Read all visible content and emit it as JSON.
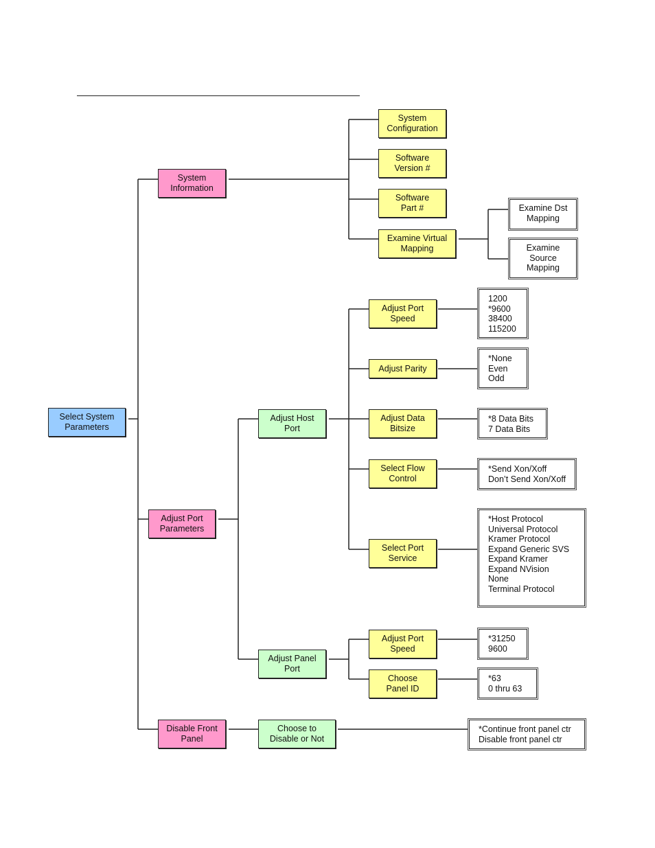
{
  "diagram": {
    "root": {
      "label": "Select System Parameters",
      "color": "#99ccff"
    },
    "colors": {
      "level1": "#ff99cc",
      "level2": "#ccffcc",
      "leaf_menu": "#ffff99",
      "options": "#ffffff"
    },
    "system_information": {
      "label": "System Information",
      "children": [
        {
          "label": "System Configuration"
        },
        {
          "label": "Software Version #"
        },
        {
          "label": "Software Part #"
        },
        {
          "label": "Examine Virtual Mapping",
          "submenus": [
            "Examine Dst Mapping",
            "Examine Source Mapping"
          ]
        }
      ]
    },
    "adjust_port_parameters": {
      "label": "Adjust Port Parameters",
      "host_port": {
        "label": "Adjust Host Port",
        "items": [
          {
            "label": "Adjust Port Speed",
            "options": [
              "1200",
              "*9600",
              "38400",
              "115200"
            ]
          },
          {
            "label": "Adjust Parity",
            "options": [
              "*None",
              "Even",
              "Odd"
            ]
          },
          {
            "label": "Adjust Data Bitsize",
            "options": [
              "*8 Data Bits",
              "7 Data Bits"
            ]
          },
          {
            "label": "Select Flow Control",
            "options": [
              "*Send Xon/Xoff",
              "Don’t Send Xon/Xoff"
            ]
          },
          {
            "label": "Select Port Service",
            "options": [
              "*Host Protocol",
              "Universal Protocol",
              "Kramer Protocol",
              "Expand Generic SVS",
              "Expand Kramer",
              "Expand NVision",
              "None",
              "Terminal Protocol"
            ]
          }
        ]
      },
      "panel_port": {
        "label": "Adjust Panel Port",
        "items": [
          {
            "label": "Adjust Port Speed",
            "options": [
              "*31250",
              "9600"
            ]
          },
          {
            "label": "Choose Panel ID",
            "options": [
              "*63",
              "0 thru 63"
            ]
          }
        ]
      }
    },
    "disable_front_panel": {
      "label": "Disable Front Panel",
      "child": {
        "label": "Choose to Disable or Not",
        "options": [
          "*Continue front panel ctr",
          "Disable front panel ctr"
        ]
      }
    }
  }
}
